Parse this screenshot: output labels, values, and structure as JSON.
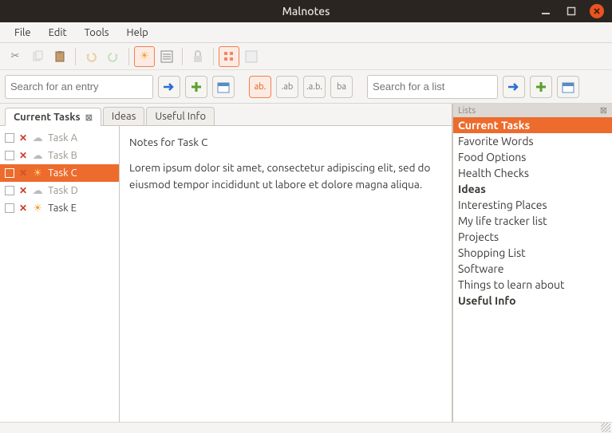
{
  "window": {
    "title": "Malnotes"
  },
  "menu": {
    "file": "File",
    "edit": "Edit",
    "tools": "Tools",
    "help": "Help"
  },
  "search": {
    "entry_placeholder": "Search for an entry",
    "list_placeholder": "Search for a list"
  },
  "tabs": [
    {
      "label": "Current Tasks",
      "active": true
    },
    {
      "label": "Ideas",
      "active": false
    },
    {
      "label": "Useful Info",
      "active": false
    }
  ],
  "tasks": [
    {
      "label": "Task A",
      "selected": false,
      "starred": false
    },
    {
      "label": "Task B",
      "selected": false,
      "starred": false
    },
    {
      "label": "Task C",
      "selected": true,
      "starred": true
    },
    {
      "label": "Task D",
      "selected": false,
      "starred": false
    },
    {
      "label": "Task E",
      "selected": false,
      "starred": true
    }
  ],
  "editor": {
    "title": "Notes for Task C",
    "body": "Lorem ipsum dolor sit amet, consectetur adipiscing elit, sed do eiusmod tempor incididunt ut labore et dolore magna aliqua."
  },
  "right_panel": {
    "header": "Lists",
    "items": [
      {
        "label": "Current Tasks",
        "selected": true,
        "bold": true
      },
      {
        "label": "Favorite Words"
      },
      {
        "label": "Food Options"
      },
      {
        "label": "Health Checks"
      },
      {
        "label": "Ideas",
        "bold": true
      },
      {
        "label": "Interesting Places"
      },
      {
        "label": "My life tracker list"
      },
      {
        "label": "Projects"
      },
      {
        "label": "Shopping List"
      },
      {
        "label": "Software"
      },
      {
        "label": "Things to learn about"
      },
      {
        "label": "Useful Info",
        "bold": true
      }
    ]
  },
  "filter_buttons": {
    "ab_dot": "ab.",
    "dot_ab": ".ab",
    "a_b": ".a.b.",
    "ba": "ba"
  }
}
